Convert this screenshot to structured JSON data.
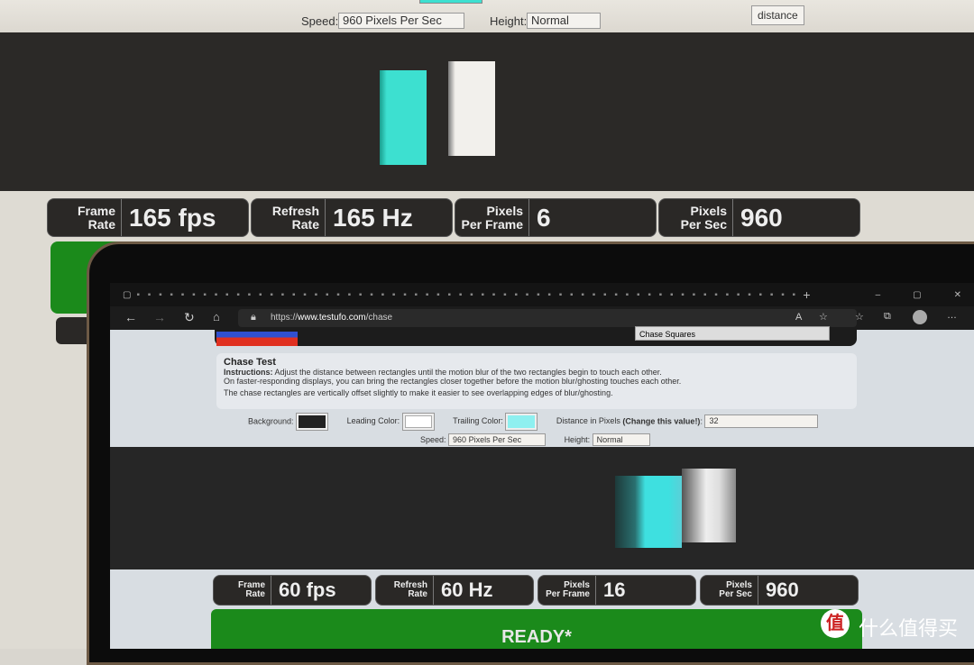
{
  "background_monitor": {
    "speed_label": "Speed:",
    "speed_value": "960 Pixels Per Sec",
    "height_label": "Height:",
    "height_value": "Normal",
    "distance_tooltip": "distance",
    "stats": [
      {
        "label1": "Frame",
        "label2": "Rate",
        "value": "165 fps"
      },
      {
        "label1": "Refresh",
        "label2": "Rate",
        "value": "165 Hz"
      },
      {
        "label1": "Pixels",
        "label2": "Per Frame",
        "value": "6"
      },
      {
        "label1": "Pixels",
        "label2": "Per Sec",
        "value": "960"
      }
    ]
  },
  "laptop": {
    "url_prefix": "https://",
    "url_domain": "www.testufo.com",
    "url_path": "/chase",
    "test_select": "Chase Squares",
    "title": "Chase Test",
    "instructions_label": "Instructions:",
    "instructions": "Adjust the distance between rectangles until the motion blur of the two rectangles begin to touch each other.",
    "line2": "On faster-responding displays, you can bring the rectangles closer together before the motion blur/ghosting touches each other.",
    "line3": "The chase rectangles are vertically offset slightly to make it easier to see overlapping edges of blur/ghosting.",
    "background_label": "Background:",
    "leading_label": "Leading Color:",
    "trailing_label": "Trailing Color:",
    "distance_label": "Distance in Pixels",
    "distance_bold": "(Change this value!)",
    "distance_colon": ":",
    "distance_value": "32",
    "speed_label": "Speed:",
    "speed_value": "960 Pixels Per Sec",
    "height_label": "Height:",
    "height_value": "Normal",
    "stats": [
      {
        "label1": "Frame",
        "label2": "Rate",
        "value": "60 fps"
      },
      {
        "label1": "Refresh",
        "label2": "Rate",
        "value": "60 Hz"
      },
      {
        "label1": "Pixels",
        "label2": "Per Frame",
        "value": "16"
      },
      {
        "label1": "Pixels",
        "label2": "Per Sec",
        "value": "960"
      }
    ],
    "status": "READY*"
  },
  "watermark": "什么值得买",
  "colors": {
    "trailing": "#3de0d0",
    "leading": "#f2f0ec",
    "ready": "#1b8a1b",
    "background": "#2b2927"
  }
}
